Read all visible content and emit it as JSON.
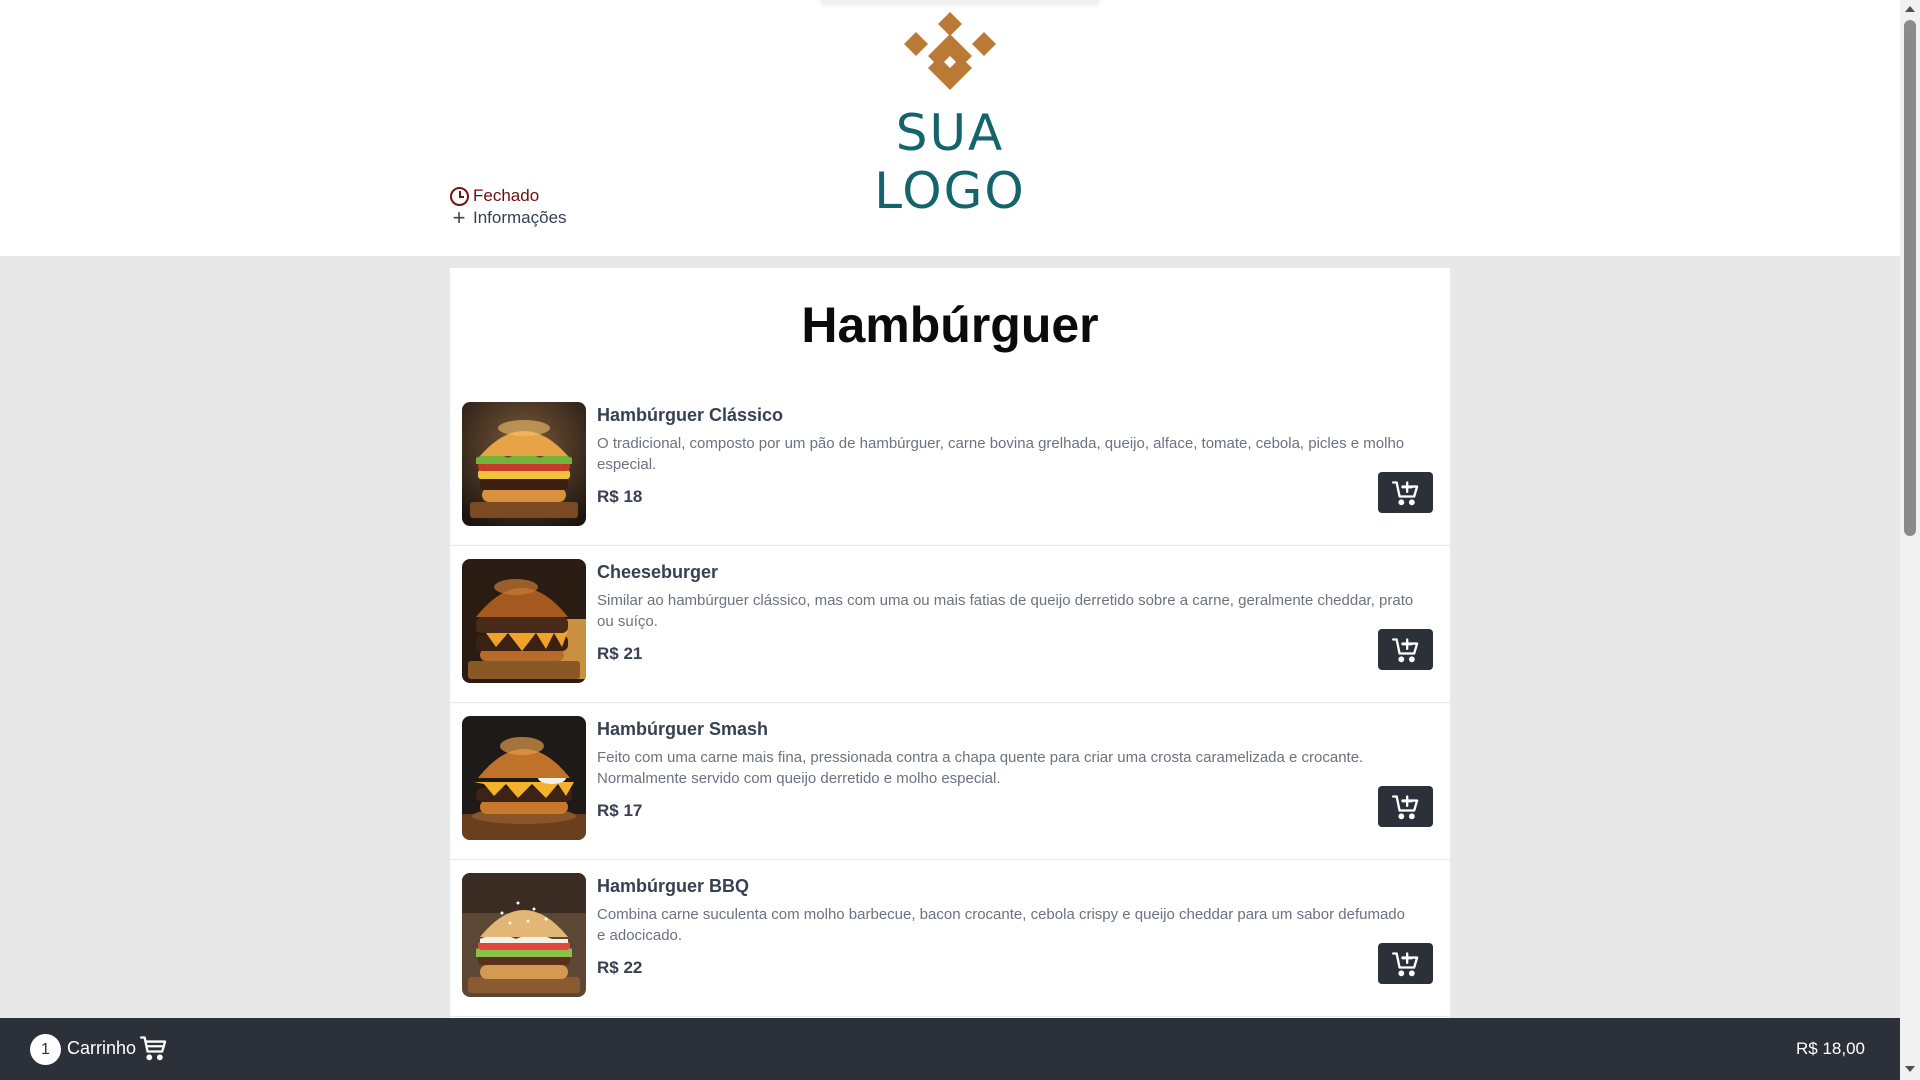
{
  "header": {
    "logo_text": "SUA LOGO",
    "status": "Fechado",
    "info_link": "Informações",
    "colors": {
      "logo_mark": "#b97a35",
      "logo_text": "#15636b",
      "status": "#6b0f0f"
    }
  },
  "menu": {
    "title": "Hambúrguer",
    "items": [
      {
        "name": "Hambúrguer Clássico",
        "description": "O tradicional, composto por um pão de hambúrguer, carne bovina grelhada, queijo, alface, tomate, cebola, picles e molho especial.",
        "price": "R$ 18",
        "icon": "add-to-cart-icon"
      },
      {
        "name": "Cheeseburger",
        "description": "Similar ao hambúrguer clássico, mas com uma ou mais fatias de queijo derretido sobre a carne, geralmente cheddar, prato ou suíço.",
        "price": "R$ 21",
        "icon": "add-to-cart-icon"
      },
      {
        "name": "Hambúrguer Smash",
        "description": "Feito com uma carne mais fina, pressionada contra a chapa quente para criar uma crosta caramelizada e crocante. Normalmente servido com queijo derretido e molho especial.",
        "price": "R$ 17",
        "icon": "add-to-cart-icon"
      },
      {
        "name": "Hambúrguer BBQ",
        "description": "Combina carne suculenta com molho barbecue, bacon crocante, cebola crispy e queijo cheddar para um sabor defumado e adocicado.",
        "price": "R$ 22",
        "icon": "add-to-cart-icon"
      }
    ]
  },
  "cart_bar": {
    "count": "1",
    "label": "Carrinho",
    "total": "R$ 18,00",
    "icon": "shopping-cart-icon",
    "color": "#2b3039"
  }
}
